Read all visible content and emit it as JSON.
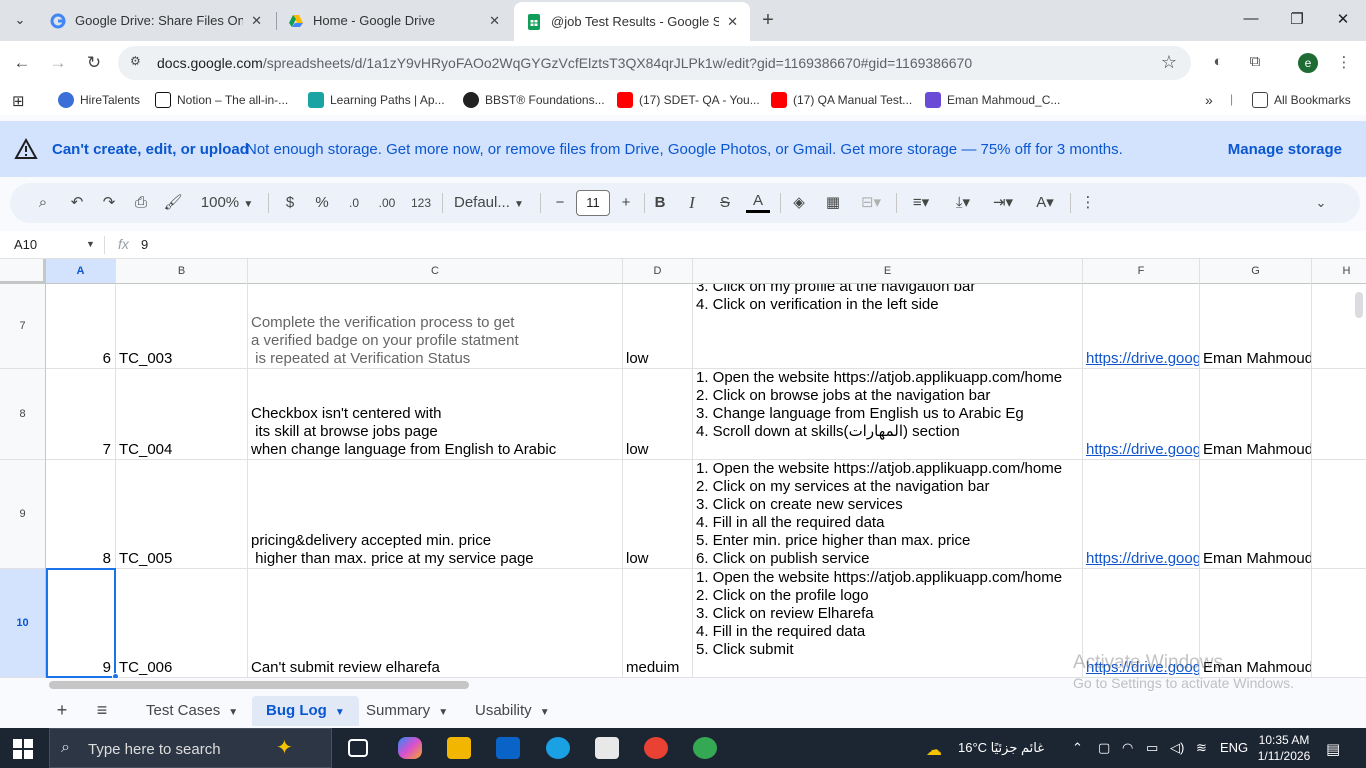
{
  "browser": {
    "tabs": [
      {
        "title": "Google Drive: Share Files Online",
        "active": false
      },
      {
        "title": "Home - Google Drive",
        "active": false
      },
      {
        "title": "@job Test Results - Google She",
        "active": true
      }
    ],
    "url_host": "docs.google.com",
    "url_path": "/spreadsheets/d/1a1zY9vHRyoFAOo2WqGYGzVcfElztsT3QX84qrJLPk1w/edit?gid=1169386670#gid=1169386670",
    "profile_initial": "e",
    "bookmarks": [
      {
        "label": "HireTalents",
        "color": "#3b6fd8"
      },
      {
        "label": "Notion – The all-in-...",
        "color": "#111111"
      },
      {
        "label": "Learning Paths | Ap...",
        "color": "#1aa3a3"
      },
      {
        "label": "BBST® Foundations...",
        "color": "#222222"
      },
      {
        "label": "(17) SDET- QA - You...",
        "color": "#ff0000"
      },
      {
        "label": "(17) QA Manual Test...",
        "color": "#ff0000"
      },
      {
        "label": "Eman Mahmoud_C...",
        "color": "#6a4bd6"
      }
    ],
    "all_bookmarks_label": "All Bookmarks"
  },
  "banner": {
    "title": "Can't create, edit, or upload",
    "message": "Not enough storage. Get more now, or remove files from Drive, Google Photos, or Gmail. Get more storage — 75% off for 3 months.",
    "action": "Manage storage"
  },
  "toolbar": {
    "zoom": "100%",
    "currency": "$",
    "percent": "%",
    "dec_decrease": ".0",
    "dec_increase": ".00",
    "number_format": "123",
    "font": "Defaul...",
    "font_size": "11"
  },
  "formula_bar": {
    "cell_ref": "A10",
    "fx": "fx",
    "value": "9"
  },
  "columns": [
    "A",
    "B",
    "C",
    "D",
    "E",
    "F",
    "G",
    "H"
  ],
  "rows": [
    {
      "num": "7",
      "a": "6",
      "b": "TC_003",
      "c": "Complete the verification process to get\na verified badge on your profile statment\n is repeated at Verification Status",
      "d": "low",
      "e": "3. Click on my profile at the navigation bar\n4. Click on verification in the left side",
      "f": "https://drive.goog",
      "g": "Eman Mahmoud"
    },
    {
      "num": "8",
      "a": "7",
      "b": "TC_004",
      "c": "Checkbox isn't centered with\n its skill at browse jobs page\nwhen change language from English to Arabic",
      "d": "low",
      "e": "1. Open the website https://atjob.applikuapp.com/home\n2. Click on browse jobs at the navigation bar\n3. Change language from English us to Arabic Eg\n4. Scroll down at skills(المهارات) section",
      "f": "https://drive.goog",
      "g": "Eman Mahmoud"
    },
    {
      "num": "9",
      "a": "8",
      "b": "TC_005",
      "c": "pricing&delivery accepted min. price\n higher than max. price at my service page",
      "d": "low",
      "e": "1. Open the website https://atjob.applikuapp.com/home\n2. Click on my services at the navigation bar\n3. Click on create new services\n4. Fill in all the required data\n5. Enter min. price higher than max. price\n6. Click on publish service",
      "f": "https://drive.goog",
      "g": "Eman Mahmoud"
    },
    {
      "num": "10",
      "a": "9",
      "b": "TC_006",
      "c": "Can't submit review elharefa",
      "d": "meduim",
      "e": "1. Open the website https://atjob.applikuapp.com/home\n2. Click on the profile logo\n3. Click on review Elharefa\n4. Fill in the required data\n5. Click submit",
      "f": "https://drive.goog",
      "g": "Eman Mahmoud"
    }
  ],
  "watermark": {
    "line1": "Activate Windows",
    "line2": "Go to Settings to activate Windows."
  },
  "sheet_tabs": [
    {
      "label": "Test Cases",
      "active": false
    },
    {
      "label": "Bug Log",
      "active": true
    },
    {
      "label": "Summary",
      "active": false
    },
    {
      "label": "Usability",
      "active": false
    }
  ],
  "taskbar": {
    "search_placeholder": "Type here to search",
    "weather": "16°C  غائم جزئيًا",
    "language": "ENG",
    "time": "10:35 AM",
    "date": "1/11/2026"
  }
}
